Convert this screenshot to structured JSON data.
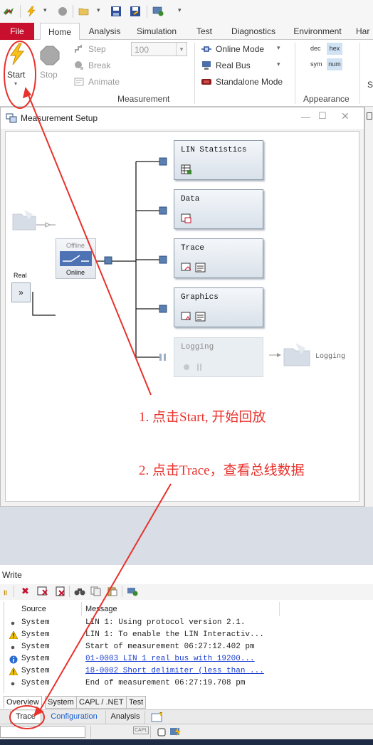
{
  "ribbon_tabs": {
    "file": "File",
    "home": "Home",
    "analysis": "Analysis",
    "simulation": "Simulation",
    "test": "Test",
    "diagnostics": "Diagnostics",
    "environment": "Environment",
    "hardware_partial": "Har"
  },
  "ribbon": {
    "start": "Start",
    "stop": "Stop",
    "step": "Step",
    "break": "Break",
    "animate": "Animate",
    "speed_value": "100",
    "online_mode": "Online Mode",
    "real_bus": "Real Bus",
    "standalone_mode": "Standalone Mode",
    "group_measurement": "Measurement",
    "dec": "dec",
    "hex": "hex",
    "sym": "sym",
    "num": "num",
    "group_appearance": "Appearance",
    "partial_s": "S"
  },
  "measurement_setup": {
    "title": "Measurement Setup",
    "offline": "Offline",
    "online": "Online",
    "real": "Real",
    "real_button": "»",
    "blocks": {
      "lin_statistics": "LIN Statistics",
      "data": "Data",
      "trace": "Trace",
      "graphics": "Graphics",
      "logging": "Logging"
    },
    "logging_label": "Logging"
  },
  "annotations": {
    "step1": "1. 点击Start, 开始回放",
    "step2": "2. 点击Trace，查看总线数据"
  },
  "write": {
    "title": "Write",
    "col_source": "Source",
    "col_message": "Message",
    "rows": [
      {
        "icon": "dot",
        "source": "System",
        "message": "LIN 1: Using protocol version 2.1.",
        "link": false
      },
      {
        "icon": "warning",
        "source": "System",
        "message": "LIN 1: To enable the LIN Interactiv...",
        "link": false
      },
      {
        "icon": "dot",
        "source": "System",
        "message": "Start of measurement 06:27:12.402 pm",
        "link": false
      },
      {
        "icon": "info",
        "source": "System",
        "message": "01-0003 LIN 1   real bus with 19200...",
        "link": true
      },
      {
        "icon": "warning",
        "source": "System",
        "message": "18-0002 Short delimiter (less than ...",
        "link": true
      },
      {
        "icon": "dot",
        "source": "System",
        "message": "End of measurement 06:27:19.708 pm",
        "link": false
      }
    ],
    "tabs": [
      "Overview",
      "System",
      "CAPL / .NET",
      "Test"
    ]
  },
  "bottom_tabs": {
    "trace": "Trace",
    "configuration": "Configuration",
    "analysis": "Analysis"
  },
  "status": {
    "capl": "CAPL"
  },
  "colors": {
    "file_tab": "#c8102e",
    "annotation": "#e8322c",
    "link": "#1a3ecf",
    "block_connector": "#5a7fb0"
  }
}
